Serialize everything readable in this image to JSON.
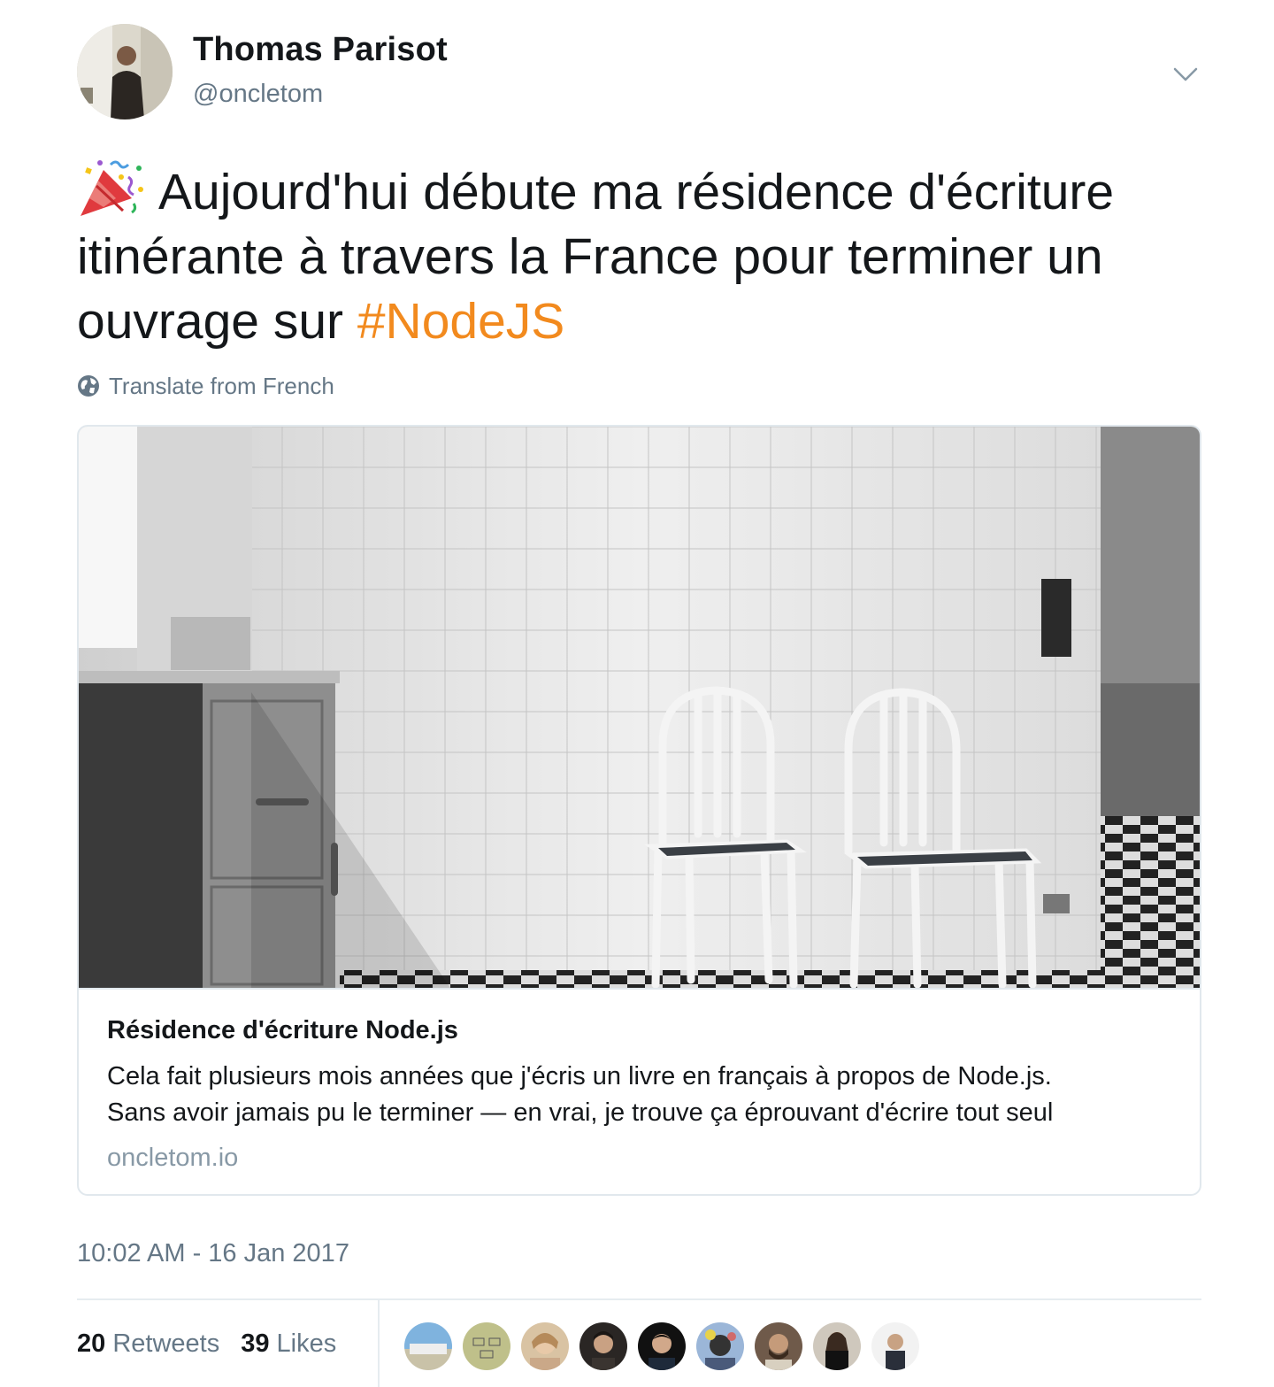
{
  "author": {
    "name": "Thomas Parisot",
    "handle": "@oncletom"
  },
  "tweet": {
    "emoji": "party-popper-icon",
    "text": "Aujourd'hui débute ma résidence d'écriture itinérante à travers la France pour terminer un ouvrage sur ",
    "hashtag": "#NodeJS",
    "translate_label": "Translate from French"
  },
  "card": {
    "title": "Résidence d'écriture Node.js",
    "description_line1": "Cela fait plusieurs mois années que j'écris un livre en français à propos de Node.js.",
    "description_line2": "Sans avoir jamais pu le terminer — en vrai, je trouve ça éprouvant d'écrire tout seul",
    "domain": "oncletom.io"
  },
  "timestamp": "10:02 AM - 16 Jan 2017",
  "stats": {
    "retweets_count": "20",
    "retweets_label": "Retweets",
    "likes_count": "39",
    "likes_label": "Likes"
  },
  "colors": {
    "hashtag": "#f28a1e",
    "secondary_text": "#657786",
    "border": "#e1e8ed"
  }
}
